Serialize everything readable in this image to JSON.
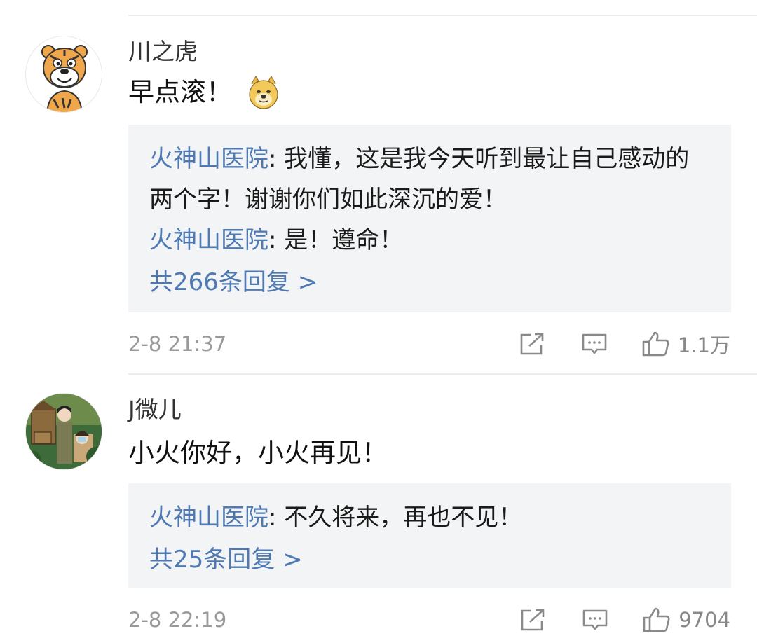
{
  "comments": [
    {
      "username": "川之虎",
      "text": "早点滚！",
      "emoji": "doge-emoji",
      "replies": [
        {
          "author": "火神山医院",
          "sep": ": ",
          "text": "我懂，这是我今天听到最让自己感动的两个字！谢谢你们如此深沉的爱！"
        },
        {
          "author": "火神山医院",
          "sep": ": ",
          "text": "是！遵命！"
        }
      ],
      "more_replies": "共266条回复 >",
      "timestamp": "2-8 21:37",
      "likes": "1.1万"
    },
    {
      "username": "J微儿",
      "text": "小火你好，小火再见！",
      "replies": [
        {
          "author": "火神山医院",
          "sep": ": ",
          "text": "不久将来，再也不见！"
        }
      ],
      "more_replies": "共25条回复 >",
      "timestamp": "2-8 22:19",
      "likes": "9704"
    }
  ],
  "icons": {
    "share": "share-icon",
    "reply": "comment-icon",
    "like": "thumbs-up-icon"
  },
  "colors": {
    "link": "#4f79b3",
    "reply_bg": "#f3f4f5",
    "meta": "#9a9a9a"
  }
}
